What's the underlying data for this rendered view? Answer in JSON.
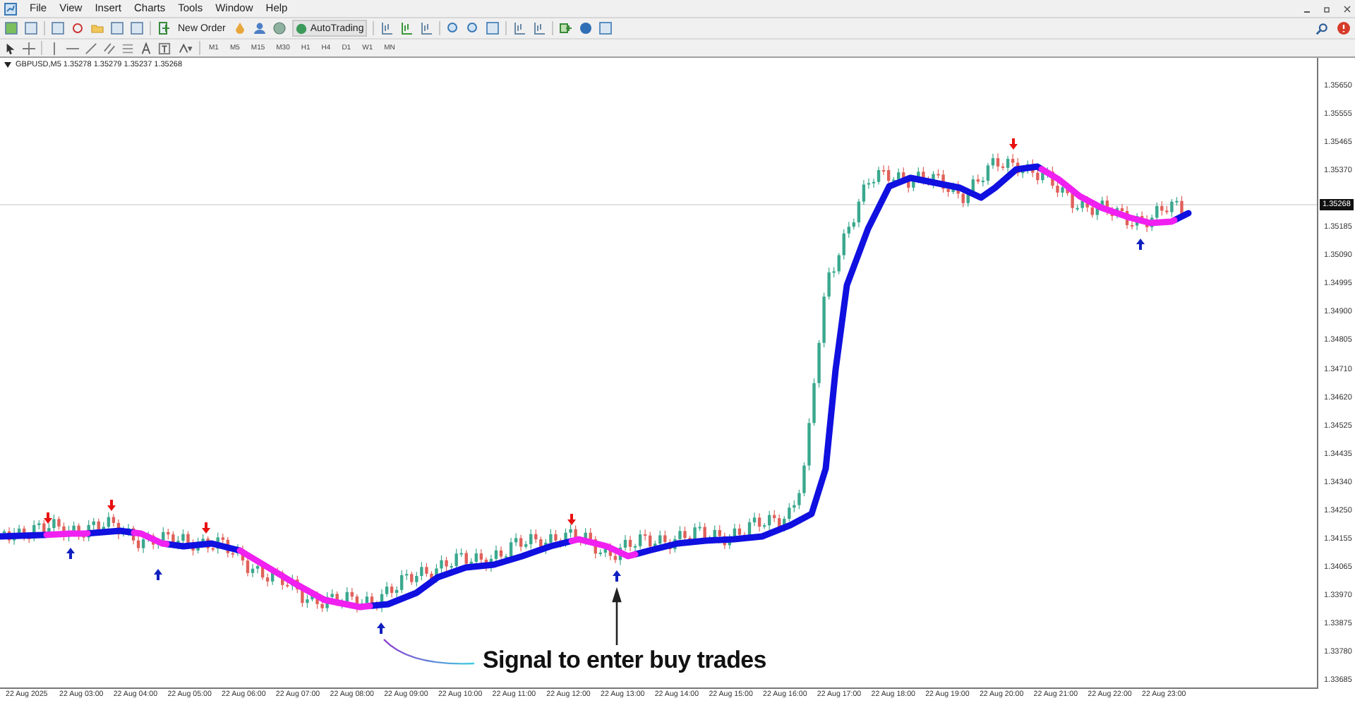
{
  "menu": [
    "File",
    "View",
    "Insert",
    "Charts",
    "Tools",
    "Window",
    "Help"
  ],
  "toolbar": {
    "new_order": "New Order",
    "auto_trading": "AutoTrading"
  },
  "timeframes": [
    "M1",
    "M5",
    "M15",
    "M30",
    "H1",
    "H4",
    "D1",
    "W1",
    "MN"
  ],
  "chart": {
    "header": "GBPUSD,M5  1.35278 1.35279 1.35237 1.35268",
    "price_labels": [
      "1.35650",
      "1.35555",
      "1.35465",
      "1.35370",
      "1.35185",
      "1.35090",
      "1.34995",
      "1.34900",
      "1.34805",
      "1.34710",
      "1.34620",
      "1.34525",
      "1.34435",
      "1.34340",
      "1.34250",
      "1.34155",
      "1.34065",
      "1.33970",
      "1.33875",
      "1.33780",
      "1.33685"
    ],
    "current_price": "1.35268",
    "time_labels": [
      "22 Aug 2025",
      "22 Aug 03:00",
      "22 Aug 04:00",
      "22 Aug 05:00",
      "22 Aug 06:00",
      "22 Aug 07:00",
      "22 Aug 08:00",
      "22 Aug 09:00",
      "22 Aug 10:00",
      "22 Aug 11:00",
      "22 Aug 12:00",
      "22 Aug 13:00",
      "22 Aug 14:00",
      "22 Aug 15:00",
      "22 Aug 16:00",
      "22 Aug 17:00",
      "22 Aug 18:00",
      "22 Aug 19:00",
      "22 Aug 20:00",
      "22 Aug 21:00",
      "22 Aug 22:00",
      "22 Aug 23:00"
    ],
    "annotation": "Signal to enter buy trades"
  }
}
